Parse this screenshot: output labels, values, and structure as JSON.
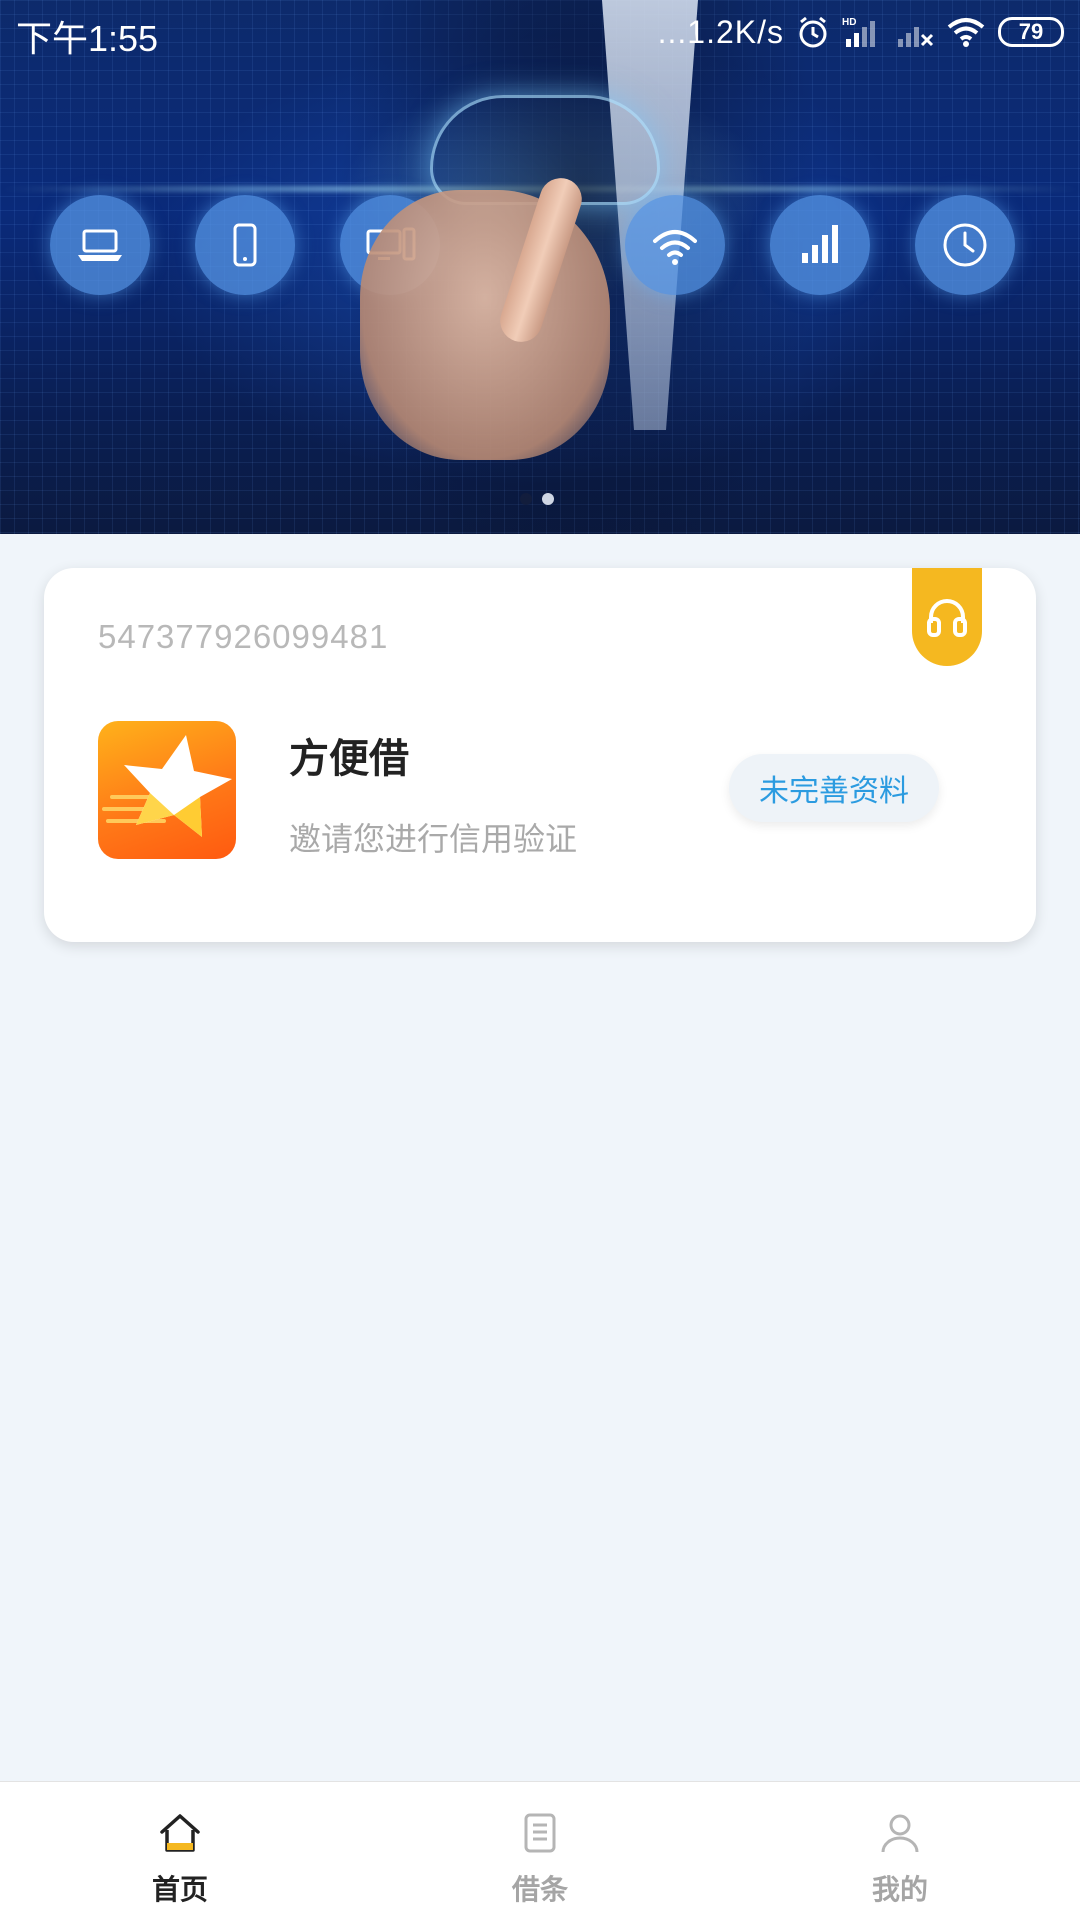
{
  "status_bar": {
    "time": "下午1:55",
    "network_speed": "...1.2K/s",
    "battery": "79"
  },
  "banner": {
    "tech_icons": [
      "laptop-icon",
      "phone-icon",
      "desktop-icon",
      "wifi-icon",
      "signal-bars-icon",
      "clock-icon"
    ],
    "carousel": {
      "total": 2,
      "active_index": 1
    }
  },
  "card": {
    "id_number": "547377926099481",
    "app_name": "方便借",
    "subtitle": "邀请您进行信用验证",
    "status_button": "未完善资料",
    "support_icon": "headset-icon"
  },
  "colors": {
    "accent_yellow": "#f5b820",
    "status_blue": "#2b9be0",
    "page_bg": "#f0f5fa"
  },
  "nav": {
    "items": [
      {
        "label": "首页",
        "icon": "home-icon",
        "active": true
      },
      {
        "label": "借条",
        "icon": "document-icon",
        "active": false
      },
      {
        "label": "我的",
        "icon": "user-icon",
        "active": false
      }
    ]
  }
}
